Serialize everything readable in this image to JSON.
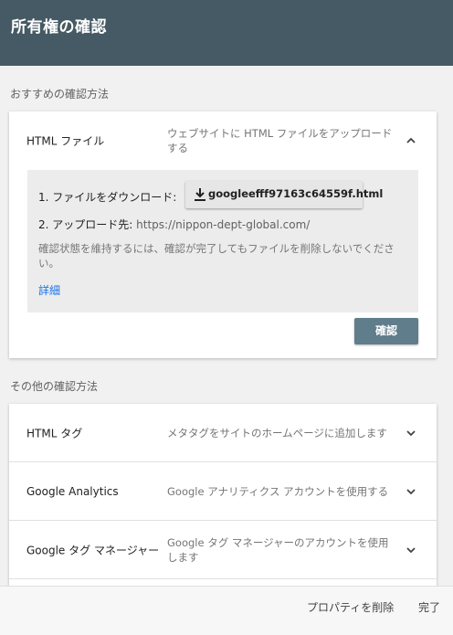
{
  "header": {
    "title": "所有権の確認"
  },
  "recommended": {
    "label": "おすすめの確認方法",
    "method": {
      "name": "HTML ファイル",
      "description": "ウェブサイトに HTML ファイルをアップロードする",
      "step1_label": "1. ファイルをダウンロード:",
      "download_file": "googleefff97163c64559f.html",
      "step2_label": "2. アップロード先:",
      "upload_url": "https://nippon-dept-global.com/",
      "note": "確認状態を維持するには、確認が完了してもファイルを削除しないでください。",
      "details_link": "詳細",
      "confirm_button": "確認"
    }
  },
  "other": {
    "label": "その他の確認方法",
    "methods": [
      {
        "name": "HTML タグ",
        "description": "メタタグをサイトのホームページに追加します"
      },
      {
        "name": "Google Analytics",
        "description": "Google アナリティクス アカウントを使用する"
      },
      {
        "name": "Google タグ マネージャー",
        "description": "Google タグ マネージャーのアカウントを使用します"
      }
    ]
  },
  "footer": {
    "delete_property": "プロパティを削除",
    "done": "完了"
  }
}
